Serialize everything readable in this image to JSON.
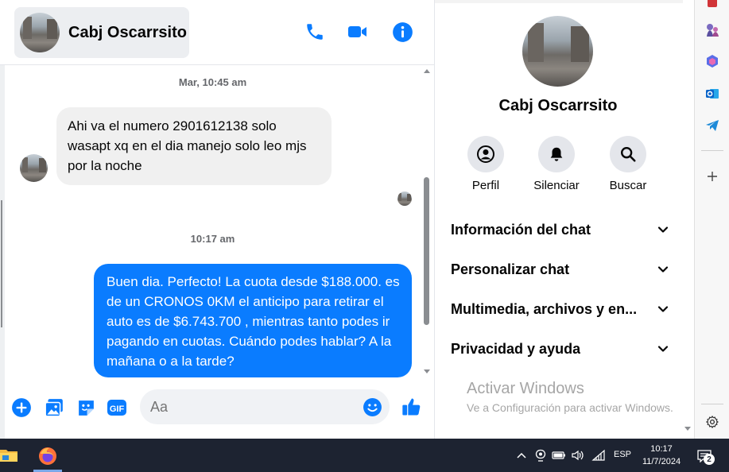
{
  "header": {
    "contact_name": "Cabj Oscarrsito"
  },
  "conversation": {
    "timestamp_1": "Mar, 10:45 am",
    "incoming_message": "Ahi va el numero 2901612138 solo wasapt xq en el dia manejo solo leo mjs por la noche",
    "timestamp_2": "10:17 am",
    "outgoing_message": "Buen dia. Perfecto! La cuota desde $188.000. es de un CRONOS 0KM el anticipo para retirar el auto es de $6.743.700 , mientras tanto podes ir pagando en cuotas. Cuándo podes hablar? A la mañana o a la tarde?"
  },
  "composer": {
    "placeholder": "Aa",
    "gif_label": "GIF"
  },
  "info_panel": {
    "name": "Cabj Oscarrsito",
    "actions": [
      {
        "label": "Perfil",
        "icon": "profile-icon"
      },
      {
        "label": "Silenciar",
        "icon": "bell-icon"
      },
      {
        "label": "Buscar",
        "icon": "search-icon"
      }
    ],
    "sections": [
      "Información del chat",
      "Personalizar chat",
      "Multimedia, archivos y en...",
      "Privacidad y ayuda"
    ]
  },
  "watermark": {
    "title": "Activar Windows",
    "subtitle": "Ve a Configuración para activar Windows."
  },
  "taskbar": {
    "language": "ESP",
    "time": "10:17",
    "date": "11/7/2024",
    "notification_count": "2"
  },
  "colors": {
    "messenger_blue": "#0a7cff",
    "incoming_bubble": "#f0f0f0",
    "taskbar": "#1d2331"
  }
}
